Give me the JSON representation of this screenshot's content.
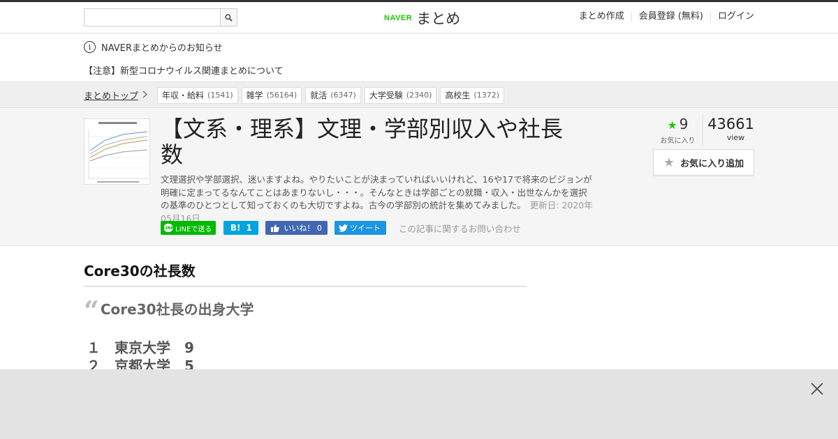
{
  "header": {
    "search_placeholder": "",
    "logo_naver": "NAVER",
    "logo_matome": "まとめ",
    "nav": [
      "まとめ作成",
      "会員登録 (無料)",
      "ログイン"
    ]
  },
  "notice": {
    "title": "NAVERまとめからのお知らせ",
    "link": "【注意】新型コロナウイルス関連まとめについて"
  },
  "breadcrumb": {
    "top": "まとめトップ",
    "tags": [
      {
        "label": "年収・給料",
        "count": "(1541)"
      },
      {
        "label": "雑学",
        "count": "(56164)"
      },
      {
        "label": "就活",
        "count": "(6347)"
      },
      {
        "label": "大学受験",
        "count": "(2340)"
      },
      {
        "label": "高校生",
        "count": "(1372)"
      }
    ]
  },
  "article": {
    "title": "【文系・理系】文理・学部別収入や社長数",
    "description": "文理選択や学部選択、迷いますよね。やりたいことが決まっていればいいけれど、16や17で将来のビジョンが明確に定まってるなんてことはあまりないし・・・。そんなときは学部ごとの就職・収入・出世なんかを選択の基準のひとつとして知っておくのも大切ですよね。古今の学部別の統計を集めてみました。",
    "updated": "更新日: 2020年05月16日",
    "favorites": "9",
    "favorites_label": "お気に入り",
    "views": "43661",
    "views_label": "view",
    "add_favorite": "お気に入り追加",
    "share": {
      "line": "LINEで送る",
      "line_badge": "LINE",
      "hatena_count": "1",
      "fb": "いいね！ 0",
      "tw": "ツイート"
    },
    "contact": "この記事に関するお問い合わせ"
  },
  "content": {
    "heading": "Core30の社長数",
    "quote_title": "Core30社長の出身大学",
    "ranking": [
      "１　東京大学　9",
      "２　京都大学　5"
    ]
  },
  "colors": {
    "brand_green": "#1ec800",
    "line_green": "#00b900",
    "hatena_blue": "#00a4de",
    "facebook_blue": "#4267b2",
    "twitter_blue": "#1b95e0"
  }
}
